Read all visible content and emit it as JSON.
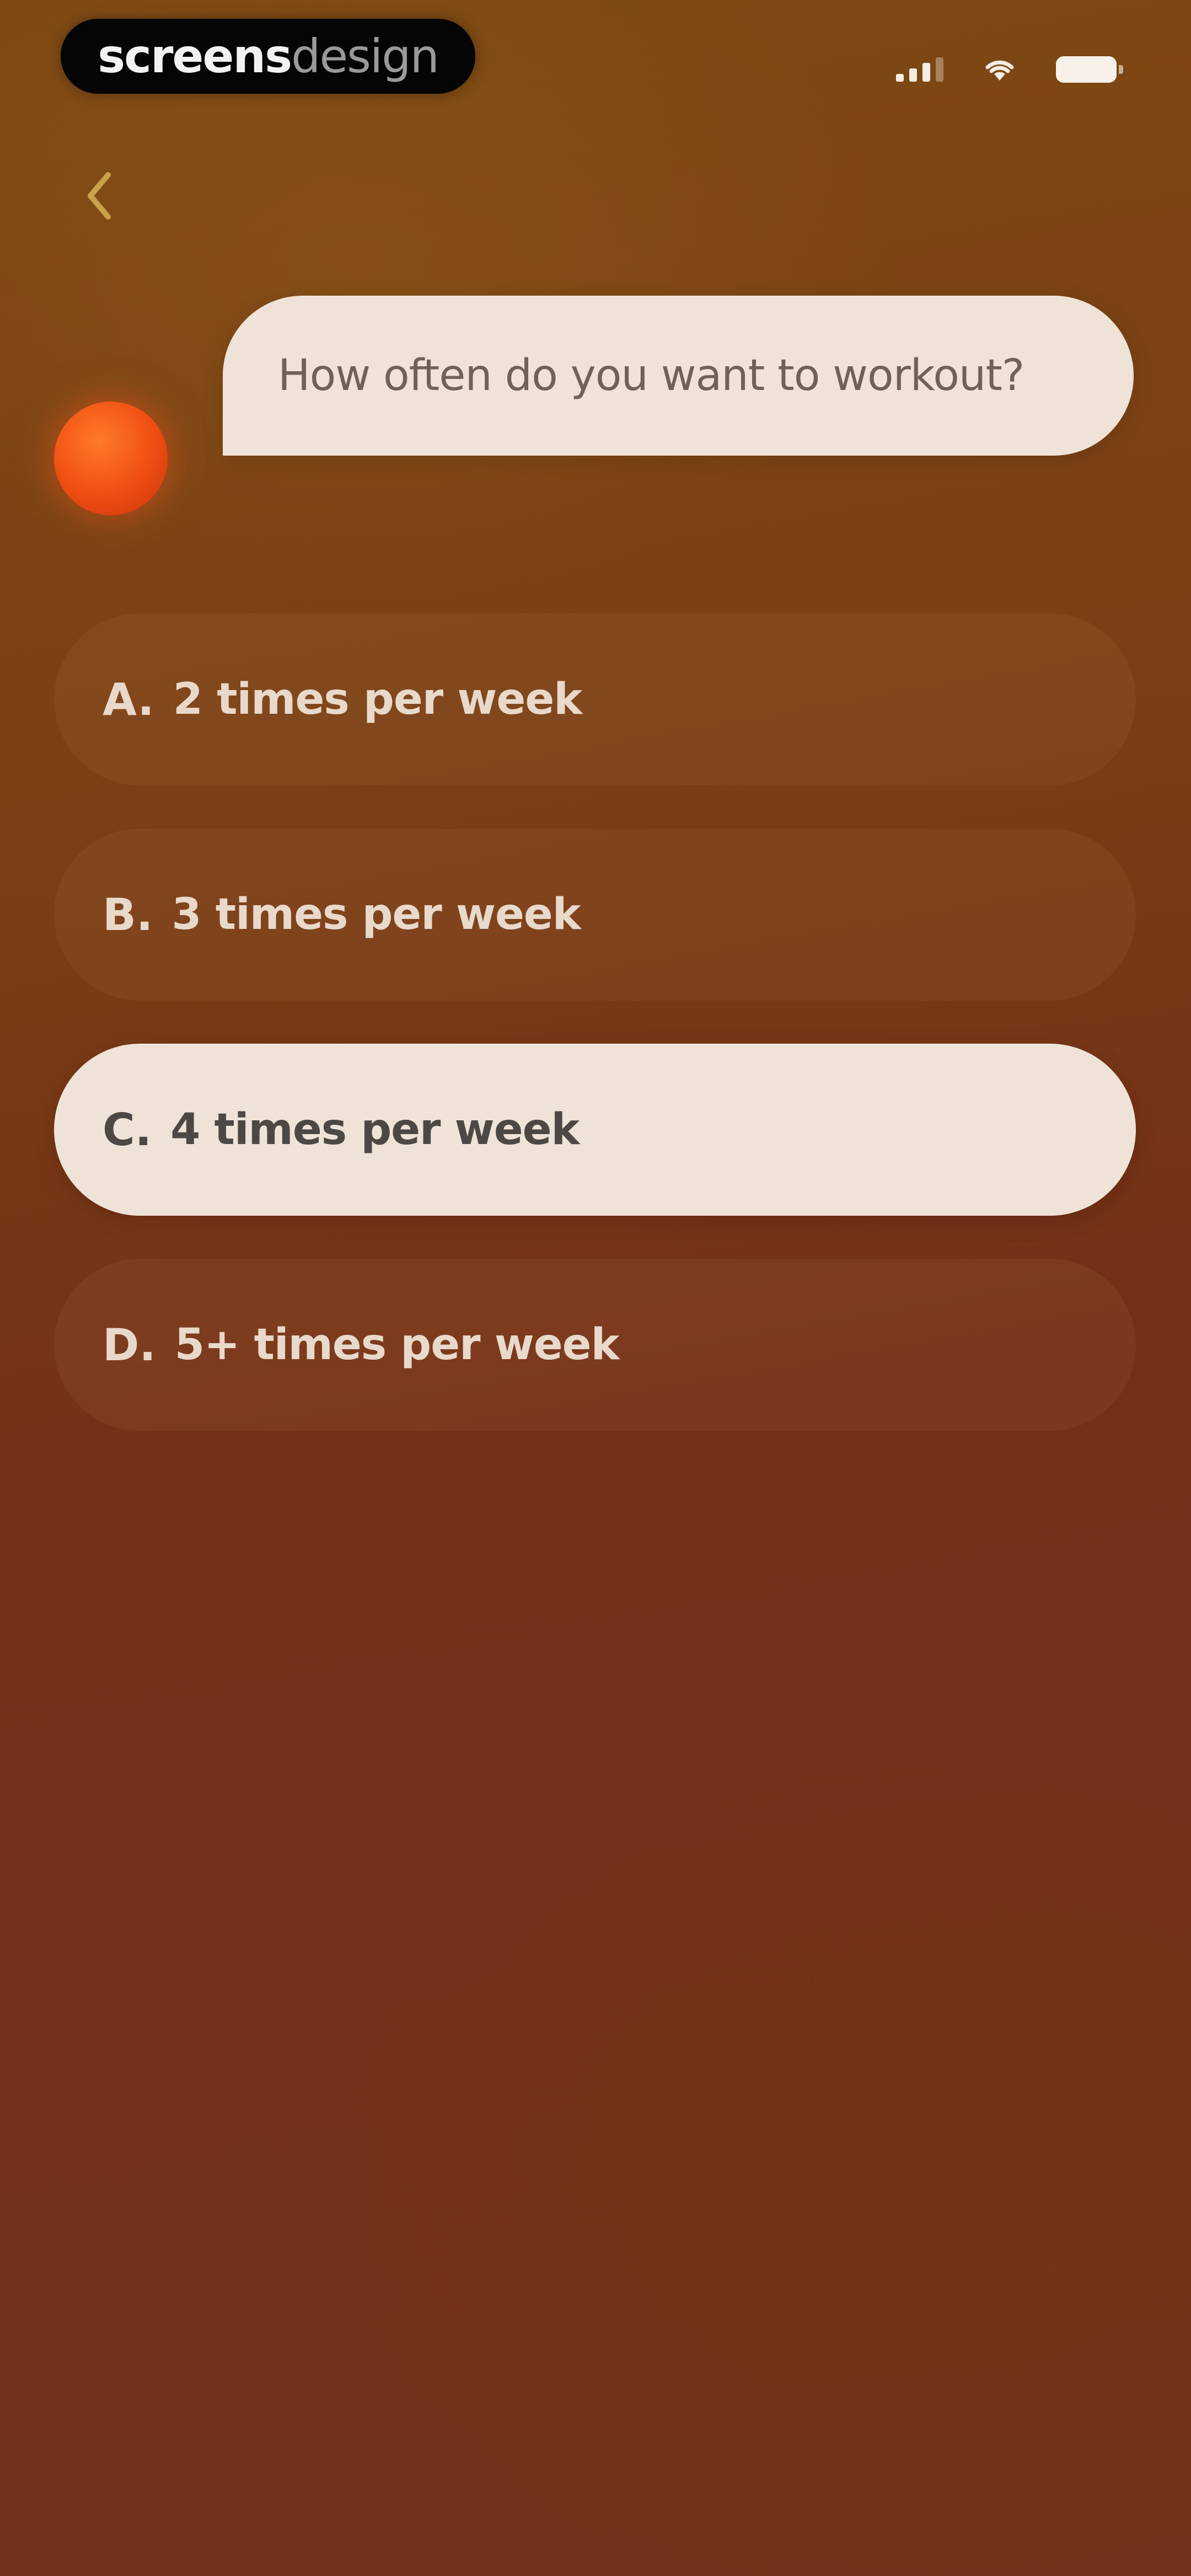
{
  "status_bar": {
    "brand_bold": "screens",
    "brand_light": "design",
    "signal_icon": "cellular-signal-icon",
    "wifi_icon": "wifi-icon",
    "battery_icon": "battery-icon"
  },
  "nav": {
    "back_icon": "chevron-left-icon",
    "back_color": "#c9a24a"
  },
  "question": {
    "text": "How often do you want to workout?",
    "avatar_color": "#ef4d12"
  },
  "options": [
    {
      "letter": "A.",
      "label": "2 times per week",
      "selected": false
    },
    {
      "letter": "B.",
      "label": "3 times per week",
      "selected": false
    },
    {
      "letter": "C.",
      "label": "4 times per week",
      "selected": true
    },
    {
      "letter": "D.",
      "label": "5+ times per week",
      "selected": false
    }
  ],
  "colors": {
    "background_top": "#7e4a12",
    "background_bottom": "#73321a",
    "bubble": "#efe3d7",
    "option_text": "#e8d9cb",
    "selected_text": "#4e4844"
  }
}
